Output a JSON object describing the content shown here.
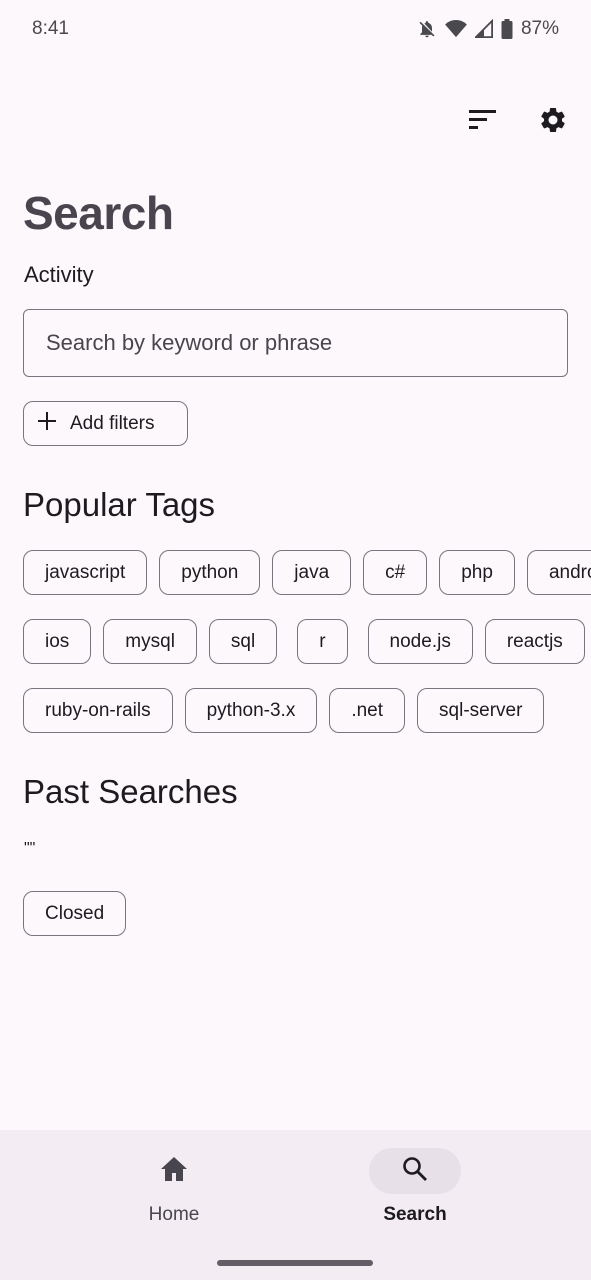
{
  "status_bar": {
    "time": "8:41",
    "battery": "87%",
    "icons": [
      "bell-off-icon",
      "wifi-icon",
      "signal-icon",
      "battery-icon"
    ]
  },
  "toolbar": {
    "sort_icon": "sort-icon",
    "settings_icon": "gear-icon"
  },
  "page": {
    "title": "Search",
    "subtitle": "Activity"
  },
  "search": {
    "placeholder": "Search by keyword or phrase",
    "value": ""
  },
  "filters": {
    "add_label": "Add filters"
  },
  "popular_tags": {
    "title": "Popular Tags",
    "rows": [
      [
        "javascript",
        "python",
        "java",
        "c#",
        "php",
        "android"
      ],
      [
        "ios",
        "mysql",
        "sql",
        "r",
        "node.js",
        "reactjs"
      ],
      [
        "ruby-on-rails",
        "python-3.x",
        ".net",
        "sql-server"
      ]
    ]
  },
  "past_searches": {
    "title": "Past Searches",
    "query": "\"\"",
    "chips": [
      "Closed"
    ]
  },
  "bottom_nav": {
    "items": [
      {
        "label": "Home",
        "icon": "home-icon",
        "active": false
      },
      {
        "label": "Search",
        "icon": "search-icon",
        "active": true
      }
    ]
  }
}
